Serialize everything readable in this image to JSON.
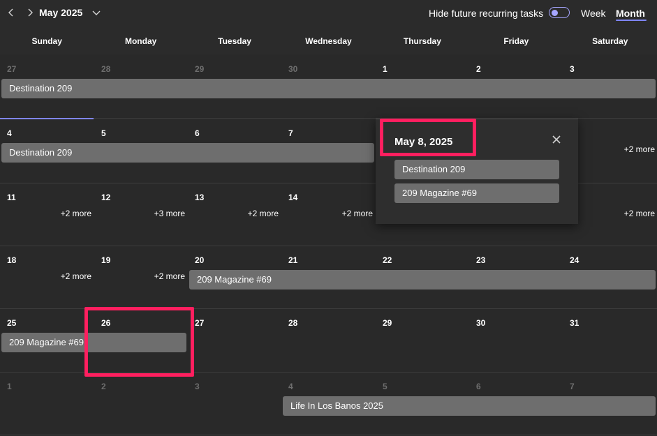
{
  "header": {
    "month_label": "May 2025",
    "hide_label": "Hide future recurring tasks",
    "view_week": "Week",
    "view_month": "Month"
  },
  "days_of_week": [
    "Sunday",
    "Monday",
    "Tuesday",
    "Wednesday",
    "Thursday",
    "Friday",
    "Saturday"
  ],
  "weeks": [
    {
      "dates": [
        "27",
        "28",
        "29",
        "30",
        "1",
        "2",
        "3"
      ],
      "muted": [
        true,
        true,
        true,
        true,
        false,
        false,
        false
      ],
      "events": [
        {
          "title": "Destination 209"
        }
      ],
      "more": []
    },
    {
      "dates": [
        "4",
        "5",
        "6",
        "7",
        "",
        "",
        ""
      ],
      "muted": [
        false,
        false,
        false,
        false,
        false,
        false,
        false
      ],
      "events": [
        {
          "title": "Destination 209"
        }
      ],
      "more": [
        "+2 more"
      ]
    },
    {
      "dates": [
        "11",
        "12",
        "13",
        "14",
        "",
        "",
        ""
      ],
      "muted": [
        false,
        false,
        false,
        false,
        false,
        false,
        false
      ],
      "events": [],
      "more": [
        "+2 more",
        "+3 more",
        "+2 more",
        "+2 more",
        "+2 more"
      ]
    },
    {
      "dates": [
        "18",
        "19",
        "20",
        "21",
        "22",
        "23",
        "24"
      ],
      "muted": [
        false,
        false,
        false,
        false,
        false,
        false,
        false
      ],
      "events": [
        {
          "title": "209 Magazine #69"
        }
      ],
      "more": [
        "+2 more",
        "+2 more"
      ]
    },
    {
      "dates": [
        "25",
        "26",
        "27",
        "28",
        "29",
        "30",
        "31"
      ],
      "muted": [
        false,
        false,
        false,
        false,
        false,
        false,
        false
      ],
      "events": [
        {
          "title": "209 Magazine #69"
        }
      ],
      "more": []
    },
    {
      "dates": [
        "1",
        "2",
        "3",
        "4",
        "5",
        "6",
        "7"
      ],
      "muted": [
        true,
        true,
        true,
        true,
        true,
        true,
        true
      ],
      "events": [
        {
          "title": "Life In Los Banos 2025"
        }
      ],
      "more": []
    }
  ],
  "popup": {
    "date": "May 8, 2025",
    "events": [
      {
        "title": "Destination 209"
      },
      {
        "title": "209 Magazine #69"
      }
    ]
  },
  "colors": {
    "background": "#292929",
    "event": "#6e6e6e",
    "accent": "#7f85f5",
    "highlight": "#ff1f5f"
  }
}
